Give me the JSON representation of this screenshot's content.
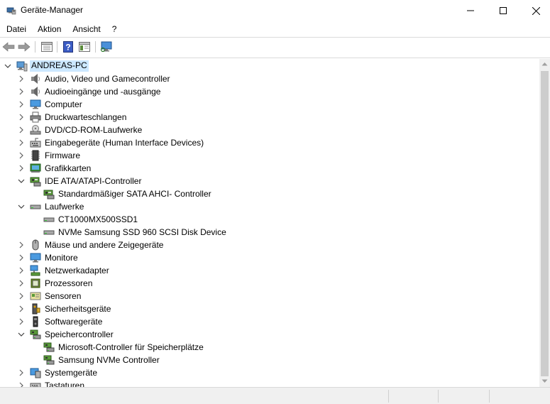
{
  "window": {
    "title": "Geräte-Manager"
  },
  "menu": {
    "items": [
      "Datei",
      "Aktion",
      "Ansicht",
      "?"
    ]
  },
  "toolbar": {
    "buttons": [
      "back-arrow-icon",
      "forward-arrow-icon",
      "properties-icon",
      "help-icon",
      "view-icon",
      "monitor-scan-icon"
    ]
  },
  "tree": {
    "root": "ANDREAS-PC",
    "items": [
      {
        "label": "Audio, Video und Gamecontroller",
        "level": 1,
        "state": "collapsed",
        "icon": "speaker-icon"
      },
      {
        "label": "Audioeingänge und -ausgänge",
        "level": 1,
        "state": "collapsed",
        "icon": "speaker-icon"
      },
      {
        "label": "Computer",
        "level": 1,
        "state": "collapsed",
        "icon": "computer-icon"
      },
      {
        "label": "Druckwarteschlangen",
        "level": 1,
        "state": "collapsed",
        "icon": "printer-icon"
      },
      {
        "label": "DVD/CD-ROM-Laufwerke",
        "level": 1,
        "state": "collapsed",
        "icon": "disc-drive-icon"
      },
      {
        "label": "Eingabegeräte (Human Interface Devices)",
        "level": 1,
        "state": "collapsed",
        "icon": "hid-icon"
      },
      {
        "label": "Firmware",
        "level": 1,
        "state": "collapsed",
        "icon": "firmware-icon"
      },
      {
        "label": "Grafikkarten",
        "level": 1,
        "state": "collapsed",
        "icon": "display-adapter-icon"
      },
      {
        "label": "IDE ATA/ATAPI-Controller",
        "level": 1,
        "state": "expanded",
        "icon": "controller-icon"
      },
      {
        "label": "Standardmäßiger SATA AHCI- Controller",
        "level": 2,
        "state": "leaf",
        "icon": "controller-icon"
      },
      {
        "label": "Laufwerke",
        "level": 1,
        "state": "expanded",
        "icon": "drive-icon"
      },
      {
        "label": "CT1000MX500SSD1",
        "level": 2,
        "state": "leaf",
        "icon": "drive-icon"
      },
      {
        "label": "NVMe Samsung SSD 960 SCSI Disk Device",
        "level": 2,
        "state": "leaf",
        "icon": "drive-icon"
      },
      {
        "label": "Mäuse und andere Zeigegeräte",
        "level": 1,
        "state": "collapsed",
        "icon": "mouse-icon"
      },
      {
        "label": "Monitore",
        "level": 1,
        "state": "collapsed",
        "icon": "monitor-icon"
      },
      {
        "label": "Netzwerkadapter",
        "level": 1,
        "state": "collapsed",
        "icon": "network-icon"
      },
      {
        "label": "Prozessoren",
        "level": 1,
        "state": "collapsed",
        "icon": "processor-icon"
      },
      {
        "label": "Sensoren",
        "level": 1,
        "state": "collapsed",
        "icon": "sensor-icon"
      },
      {
        "label": "Sicherheitsgeräte",
        "level": 1,
        "state": "collapsed",
        "icon": "security-icon"
      },
      {
        "label": "Softwaregeräte",
        "level": 1,
        "state": "collapsed",
        "icon": "software-device-icon"
      },
      {
        "label": "Speichercontroller",
        "level": 1,
        "state": "expanded",
        "icon": "storage-controller-icon"
      },
      {
        "label": "Microsoft-Controller für Speicherplätze",
        "level": 2,
        "state": "leaf",
        "icon": "storage-controller-icon"
      },
      {
        "label": "Samsung NVMe Controller",
        "level": 2,
        "state": "leaf",
        "icon": "storage-controller-icon"
      },
      {
        "label": "Systemgeräte",
        "level": 1,
        "state": "collapsed",
        "icon": "system-device-icon"
      },
      {
        "label": "Tastaturen",
        "level": 1,
        "state": "collapsed",
        "icon": "keyboard-icon"
      }
    ]
  },
  "colors": {
    "selection": "#cce8ff",
    "chevron": "#606060",
    "scrollbar_thumb": "#cdcdcd"
  }
}
